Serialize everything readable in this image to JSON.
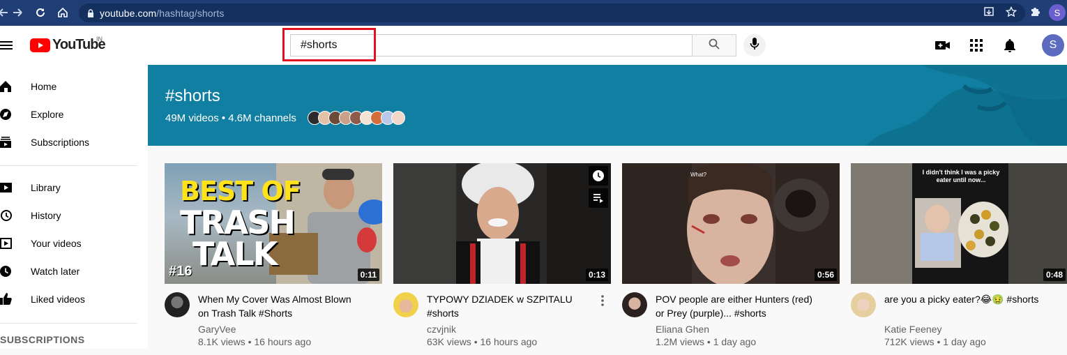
{
  "browser": {
    "url_host": "youtube.com",
    "url_path": "/hashtag/shorts",
    "profile_initial": "S"
  },
  "masthead": {
    "logo_text": "YouTube",
    "region": "IN",
    "search_value": "#shorts",
    "avatar_initial": "S"
  },
  "sidebar": {
    "items": [
      {
        "label": "Home",
        "icon": "home-icon"
      },
      {
        "label": "Explore",
        "icon": "compass-icon"
      },
      {
        "label": "Subscriptions",
        "icon": "subscriptions-icon"
      },
      {
        "label": "Library",
        "icon": "library-icon"
      },
      {
        "label": "History",
        "icon": "history-icon"
      },
      {
        "label": "Your videos",
        "icon": "your-videos-icon"
      },
      {
        "label": "Watch later",
        "icon": "clock-icon"
      },
      {
        "label": "Liked videos",
        "icon": "thumb-up-icon"
      }
    ],
    "section_title": "SUBSCRIPTIONS"
  },
  "banner": {
    "title": "#shorts",
    "subtitle": "49M videos • 4.6M channels",
    "color": "#117fa1"
  },
  "videos": [
    {
      "title": "When My Cover Was Almost Blown on Trash Talk #Shorts",
      "channel": "GaryVee",
      "stats": "8.1K views • 16 hours ago",
      "duration": "0:11",
      "thumb_text_1": "BEST OF",
      "thumb_text_2": "TRASH",
      "thumb_text_3": "TALK",
      "thumb_badge": "#16"
    },
    {
      "title": "TYPOWY DZIADEK w SZPITALU #shorts",
      "channel": "czvjnik",
      "stats": "63K views • 16 hours ago",
      "duration": "0:13"
    },
    {
      "title": "POV people are either Hunters (red) or Prey (purple)... #shorts",
      "channel": "Eliana Ghen",
      "stats": "1.2M views • 1 day ago",
      "duration": "0:56",
      "thumb_caption": "What?"
    },
    {
      "title": "are you a picky eater?😂🤢 #shorts",
      "channel": "Katie Feeney",
      "stats": "712K views • 1 day ago",
      "duration": "0:48",
      "thumb_caption": "I didn't think I was a picky eater until now..."
    }
  ]
}
